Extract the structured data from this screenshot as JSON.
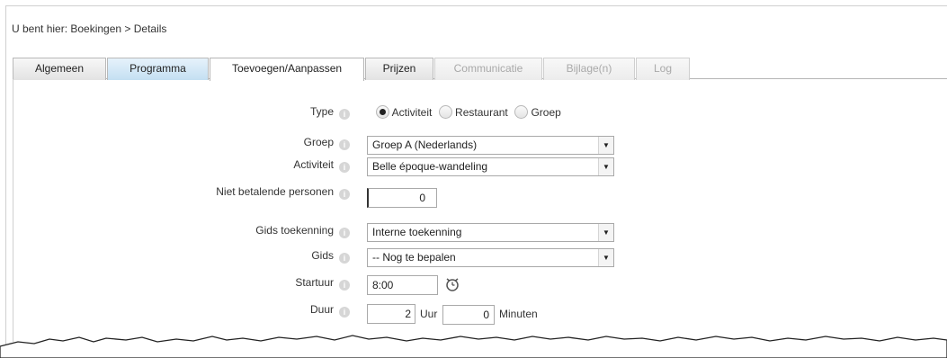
{
  "breadcrumb": "U bent hier: Boekingen > Details",
  "tabs": [
    {
      "label": "Algemeen",
      "state": "normal"
    },
    {
      "label": "Programma",
      "state": "highlight"
    },
    {
      "label": "Toevoegen/Aanpassen",
      "state": "active"
    },
    {
      "label": "Prijzen",
      "state": "normal"
    },
    {
      "label": "Communicatie",
      "state": "disabled"
    },
    {
      "label": "Bijlage(n)",
      "state": "disabled"
    },
    {
      "label": "Log",
      "state": "disabled"
    }
  ],
  "form": {
    "type": {
      "label": "Type",
      "options": [
        "Activiteit",
        "Restaurant",
        "Groep"
      ],
      "selected": "Activiteit"
    },
    "groep": {
      "label": "Groep",
      "value": "Groep A (Nederlands)"
    },
    "activiteit": {
      "label": "Activiteit",
      "value": "Belle époque-wandeling"
    },
    "niet_betalend": {
      "label": "Niet betalende personen",
      "value": "0"
    },
    "gids_toekenning": {
      "label": "Gids toekenning",
      "value": "Interne toekenning"
    },
    "gids": {
      "label": "Gids",
      "value": "-- Nog te bepalen"
    },
    "startuur": {
      "label": "Startuur",
      "value": "8:00"
    },
    "duur": {
      "label": "Duur",
      "hours": "2",
      "hours_unit": "Uur",
      "minutes": "0",
      "minutes_unit": "Minuten"
    }
  },
  "icons": {
    "info": "info-icon",
    "clock": "clock-icon",
    "dropdown": "chevron-down-icon"
  },
  "colors": {
    "tab_highlight": "#c4dff2",
    "border": "#a9a9a9",
    "disabled_text": "#a9a9a9"
  }
}
